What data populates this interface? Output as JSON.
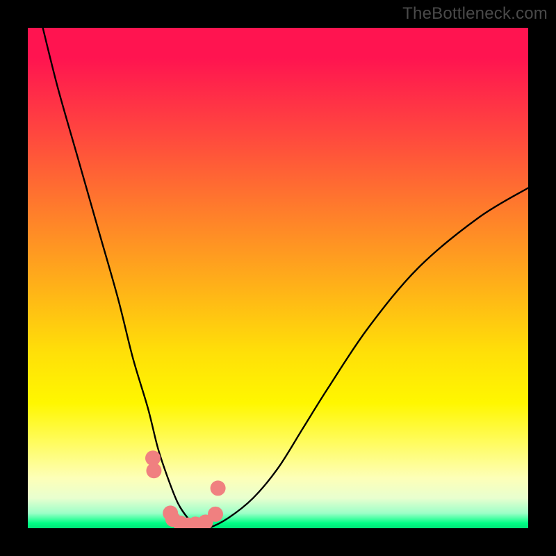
{
  "watermark": "TheBottleneck.com",
  "chart_data": {
    "type": "line",
    "title": "",
    "xlabel": "",
    "ylabel": "",
    "xlim": [
      0,
      100
    ],
    "ylim": [
      0,
      100
    ],
    "series": [
      {
        "name": "bottleneck-curve",
        "x": [
          3,
          6,
          10,
          14,
          18,
          21,
          24,
          26,
          28,
          30,
          32,
          34,
          36,
          40,
          45,
          50,
          55,
          60,
          68,
          78,
          90,
          100
        ],
        "y": [
          100,
          88,
          74,
          60,
          46,
          34,
          24,
          16,
          10,
          5,
          2,
          0,
          0,
          2,
          6,
          12,
          20,
          28,
          40,
          52,
          62,
          68
        ]
      }
    ],
    "markers": {
      "name": "highlighted-points",
      "color": "#f08080",
      "x": [
        25.0,
        25.2,
        28.5,
        29.0,
        30.5,
        32.0,
        33.5,
        35.5,
        37.5,
        38.0
      ],
      "y": [
        14.0,
        11.5,
        3.0,
        1.8,
        1.0,
        0.6,
        0.8,
        1.2,
        2.8,
        8.0
      ]
    }
  }
}
